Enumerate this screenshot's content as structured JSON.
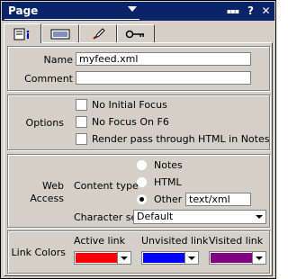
{
  "window": {
    "title": "Page",
    "buttons": {
      "menu": "▪▪▪",
      "help": "?",
      "close": "✕"
    }
  },
  "tabs": [
    {
      "icon": "info-icon",
      "active": true
    },
    {
      "icon": "form-icon",
      "active": false
    },
    {
      "icon": "rocket-icon",
      "active": false
    },
    {
      "icon": "key-icon",
      "active": false
    }
  ],
  "basics": {
    "name_label": "Name",
    "name_value": "myfeed.xml",
    "comment_label": "Comment",
    "comment_value": ""
  },
  "options": {
    "group_label": "Options",
    "no_initial_focus": "No Initial Focus",
    "no_focus_f6": "No Focus On F6",
    "render_pass_through": "Render pass through HTML in Notes"
  },
  "web_access": {
    "group_label_line1": "Web",
    "group_label_line2": "Access",
    "content_type_label": "Content type",
    "opt_notes": "Notes",
    "opt_html": "HTML",
    "opt_other": "Other",
    "other_value": "text/xml",
    "selected": "Other",
    "charset_label": "Character set",
    "charset_value": "Default"
  },
  "link_colors": {
    "group_label": "Link Colors",
    "active_label": "Active link",
    "unvisited_label": "Unvisited link",
    "visited_label": "Visited link",
    "active_color": "#ff0000",
    "unvisited_color": "#0000ff",
    "visited_color": "#800080"
  },
  "colors": {
    "titlebar": "#0a246a",
    "face": "#d4d0c8"
  }
}
